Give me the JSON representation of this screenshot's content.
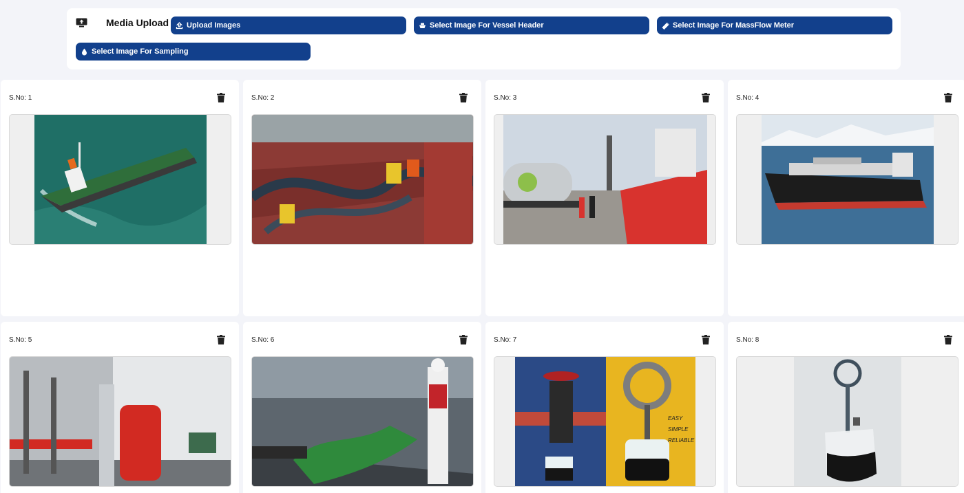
{
  "toolbar": {
    "title": "Media Upload",
    "icon": "monitor-upload-icon",
    "buttons": [
      {
        "label": "Upload Images",
        "icon": "upload-icon"
      },
      {
        "label": "Select Image For Vessel Header",
        "icon": "ship-icon"
      },
      {
        "label": "Select Image For MassFlow Meter",
        "icon": "meter-icon"
      },
      {
        "label": "Select Image For Sampling",
        "icon": "droplet-icon"
      }
    ],
    "button_color": "#12408c"
  },
  "cards": [
    {
      "sno": "S.No: 1",
      "image": "oil tanker at sea"
    },
    {
      "sno": "S.No: 2",
      "image": "deck hoses with crew"
    },
    {
      "sno": "S.No: 3",
      "image": "LNG truck at quay"
    },
    {
      "sno": "S.No: 4",
      "image": "LNG bunker vessel"
    },
    {
      "sno": "S.No: 5",
      "image": "deck pipework"
    },
    {
      "sno": "S.No: 6",
      "image": "green flow meter"
    },
    {
      "sno": "S.No: 7",
      "image": "sampling valve"
    },
    {
      "sno": "S.No: 8",
      "image": "sample bag"
    }
  ],
  "card7_overlay": [
    "EASY",
    "SIMPLE",
    "RELIABLE"
  ]
}
